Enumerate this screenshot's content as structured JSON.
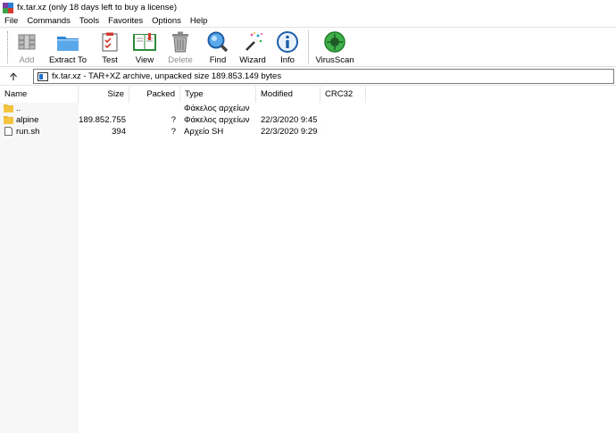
{
  "window": {
    "title": "fx.tar.xz (only 18 days left to buy a license)"
  },
  "menu": [
    "File",
    "Commands",
    "Tools",
    "Favorites",
    "Options",
    "Help"
  ],
  "toolbar": {
    "buttons": [
      {
        "label": "Add",
        "icon": "add-archive-icon",
        "enabled": false
      },
      {
        "label": "Extract To",
        "icon": "folder-extract-icon",
        "enabled": true
      },
      {
        "label": "Test",
        "icon": "test-clipboard-icon",
        "enabled": true
      },
      {
        "label": "View",
        "icon": "book-view-icon",
        "enabled": true
      },
      {
        "label": "Delete",
        "icon": "trash-icon",
        "enabled": false
      },
      {
        "label": "Find",
        "icon": "magnifier-icon",
        "enabled": true
      },
      {
        "label": "Wizard",
        "icon": "magic-wand-icon",
        "enabled": true
      },
      {
        "label": "Info",
        "icon": "info-icon",
        "enabled": true
      },
      {
        "label": "VirusScan",
        "icon": "virus-scan-icon",
        "enabled": true
      }
    ]
  },
  "address": {
    "text": "fx.tar.xz - TAR+XZ archive, unpacked size 189.853.149 bytes"
  },
  "columns": [
    "Name",
    "Size",
    "Packed",
    "Type",
    "Modified",
    "CRC32"
  ],
  "rows": [
    {
      "name": "..",
      "size": "",
      "packed": "",
      "type": "Φάκελος αρχείων",
      "modified": "",
      "icon": "folder-icon"
    },
    {
      "name": "alpine",
      "size": "189.852.755",
      "packed": "?",
      "type": "Φάκελος αρχείων",
      "modified": "22/3/2020 9:45 ...",
      "icon": "folder-icon"
    },
    {
      "name": "run.sh",
      "size": "394",
      "packed": "?",
      "type": "Αρχείο SH",
      "modified": "22/3/2020 9:29 ...",
      "icon": "file-icon"
    }
  ],
  "colors": {
    "folder": "#f5c542",
    "disabled_text": "#8f8f8f",
    "accent_blue": "#1e6fd0"
  }
}
